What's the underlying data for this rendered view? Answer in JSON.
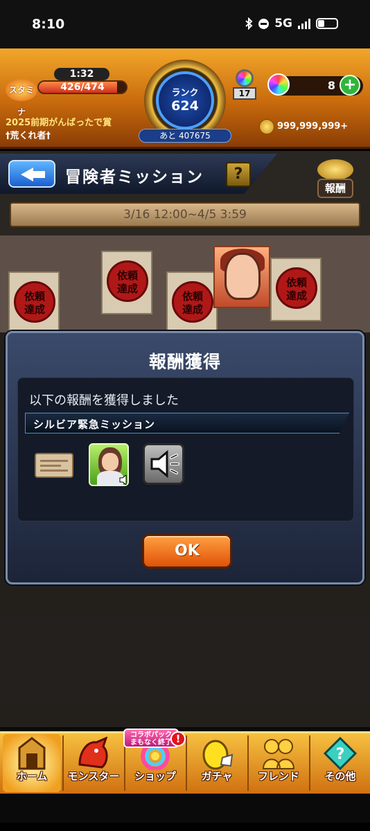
{
  "status_bar": {
    "time": "8:10",
    "network": "5G",
    "icons": [
      "bluetooth-icon",
      "do-not-disturb-icon",
      "signal-icon",
      "battery-icon"
    ]
  },
  "header": {
    "stamina_label": "スタミナ",
    "stamina_timer": "1:32",
    "stamina": "426/474",
    "stamina_fraction": 0.9,
    "title_award": "2025前期がんばったで賞",
    "title_name": "†荒くれ者†",
    "rank_label": "ランク",
    "rank_value": "624",
    "rank_next": "あと 407675",
    "gacha_tickets": "17",
    "orbs": "8",
    "coins": "999,999,999+"
  },
  "mission": {
    "title": "冒険者ミッション",
    "help": "?",
    "reward_button": "報酬",
    "period": "3/16 12:00~4/5 3:59",
    "stamp_text": "依頼\n達成"
  },
  "dialog": {
    "title": "報酬獲得",
    "message": "以下の報酬を獲得しました",
    "reward_name": "シルビア緊急ミッション",
    "rewards": [
      "ticket-card-icon",
      "character-avatar-icon",
      "voice-speaker-icon"
    ],
    "ok": "OK"
  },
  "nav": {
    "items": [
      {
        "label": "ホーム",
        "icon": "home-icon"
      },
      {
        "label": "モンスター",
        "icon": "monster-icon"
      },
      {
        "label": "ショップ",
        "icon": "shop-icon"
      },
      {
        "label": "ガチャ",
        "icon": "gacha-icon"
      },
      {
        "label": "フレンド",
        "icon": "friends-icon"
      },
      {
        "label": "その他",
        "icon": "other-icon"
      }
    ],
    "collab_badge": "コラボパック\nまもなく終了",
    "alert": "!"
  },
  "colors": {
    "header": "#e08a1a",
    "dialog": "#2a3450",
    "ok_button": "#f07a20",
    "accent_blue": "#4aa0ff"
  }
}
